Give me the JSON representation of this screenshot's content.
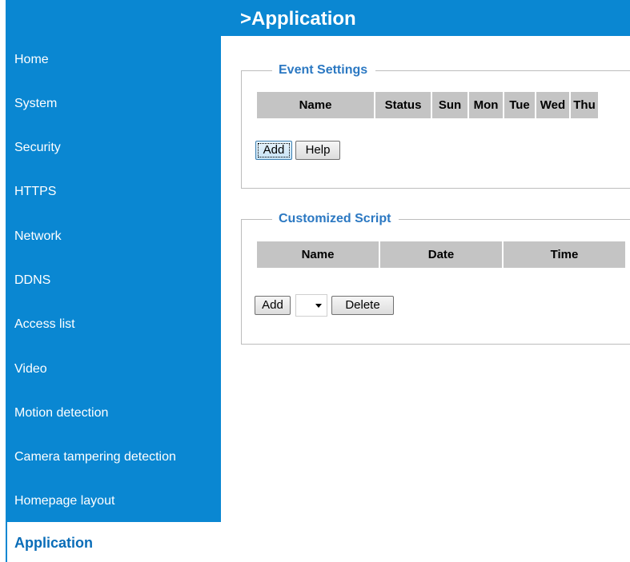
{
  "header": {
    "title": ">Application"
  },
  "sidebar": {
    "items": [
      {
        "label": "Home"
      },
      {
        "label": "System"
      },
      {
        "label": "Security"
      },
      {
        "label": "HTTPS"
      },
      {
        "label": "Network"
      },
      {
        "label": "DDNS"
      },
      {
        "label": "Access list"
      },
      {
        "label": "Video"
      },
      {
        "label": "Motion detection"
      },
      {
        "label": "Camera tampering detection"
      },
      {
        "label": "Homepage layout"
      },
      {
        "label": "Application"
      }
    ],
    "active": "Application"
  },
  "event_settings": {
    "legend": "Event Settings",
    "columns": [
      "Name",
      "Status",
      "Sun",
      "Mon",
      "Tue",
      "Wed",
      "Thu"
    ],
    "add_label": "Add",
    "help_label": "Help"
  },
  "customized_script": {
    "legend": "Customized Script",
    "columns": [
      "Name",
      "Date",
      "Time"
    ],
    "add_label": "Add",
    "select_value": "",
    "delete_label": "Delete"
  },
  "colors": {
    "accent": "#0a87d2",
    "legend_text": "#2b78c2",
    "table_header": "#c4c4c4"
  }
}
